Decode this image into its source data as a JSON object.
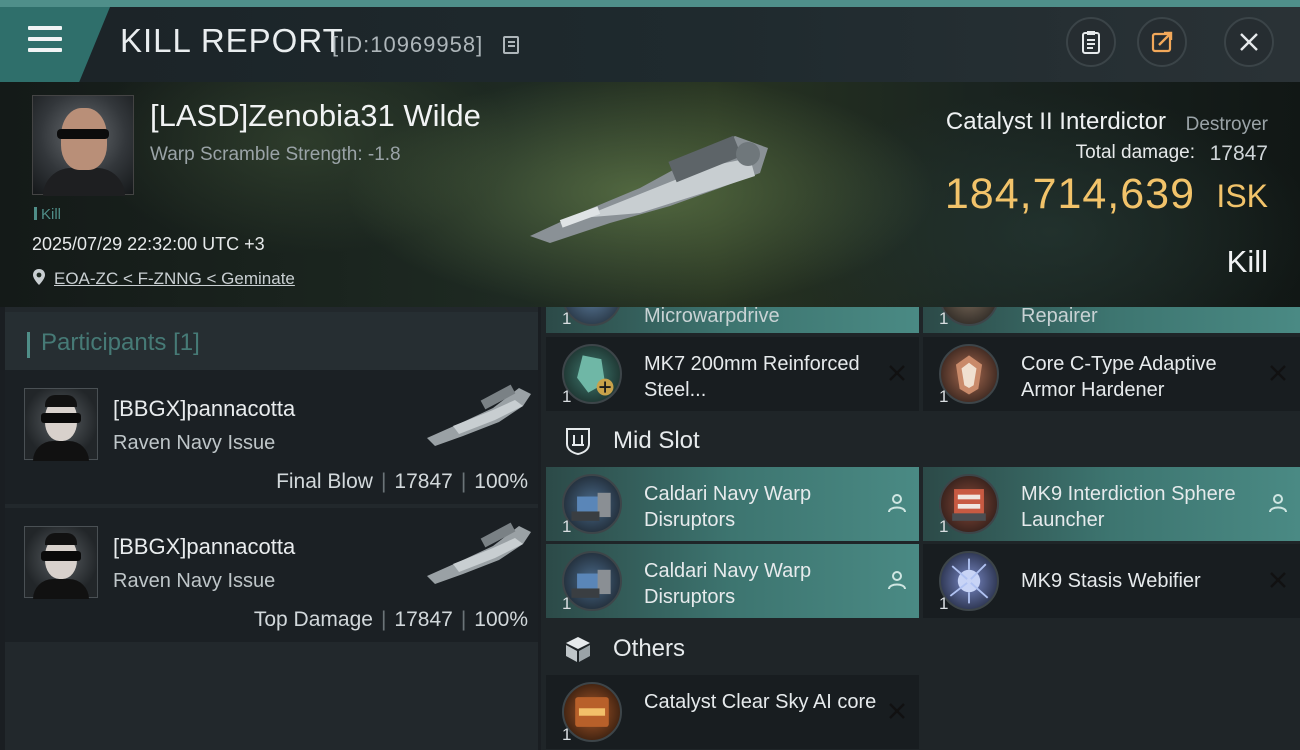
{
  "window": {
    "title": "KILL REPORT",
    "report_id": "[ID:10969958]"
  },
  "victim": {
    "name": "[LASD]Zenobia31 Wilde",
    "stat": "Warp Scramble Strength: -1.8",
    "tag": "Kill",
    "time": "2025/07/29 22:32:00 UTC +3",
    "location": "EOA-ZC < F-ZNNG < Geminate"
  },
  "ship": {
    "name": "Catalyst II Interdictor",
    "class": "Destroyer",
    "damage_label": "Total damage:",
    "damage_value": "17847",
    "isk_value": "184,714,639",
    "isk_unit": "ISK",
    "result": "Kill"
  },
  "participants": {
    "title": "Participants",
    "count": "[1]",
    "rows": [
      {
        "name": "[BBGX]pannacotta",
        "ship": "Raven Navy Issue",
        "label": "Final Blow",
        "damage": "17847",
        "percent": "100%"
      },
      {
        "name": "[BBGX]pannacotta",
        "ship": "Raven Navy Issue",
        "label": "Top Damage",
        "damage": "17847",
        "percent": "100%"
      }
    ]
  },
  "fitting": {
    "cut_modules": [
      {
        "name": "Microwarpdrive",
        "qty": "1"
      },
      {
        "name": "Repairer",
        "qty": "1"
      }
    ],
    "low_modules": [
      {
        "name": "MK7 200mm Reinforced Steel...",
        "qty": "1"
      },
      {
        "name": "Core C-Type Adaptive Armor Hardener",
        "qty": "1"
      }
    ],
    "mid_title": "Mid Slot",
    "mid_modules": [
      {
        "name": "Caldari Navy Warp Disruptors",
        "qty": "1"
      },
      {
        "name": "MK9 Interdiction Sphere Launcher",
        "qty": "1"
      },
      {
        "name": "Caldari Navy Warp Disruptors",
        "qty": "1"
      },
      {
        "name": "MK9 Stasis Webifier",
        "qty": "1"
      }
    ],
    "others_title": "Others",
    "other_modules": [
      {
        "name": "Catalyst Clear Sky AI core",
        "qty": "1"
      }
    ]
  },
  "colors": {
    "accent": "#4f8e88",
    "isk": "#f2c36a",
    "highlight": "#3d7570"
  },
  "icons": [
    "menu-icon",
    "clipboard-icon",
    "share-icon",
    "close-icon",
    "copy-icon",
    "location-pin-icon",
    "drop-icon",
    "pilot-icon",
    "mid-slot-icon",
    "cube-icon"
  ]
}
